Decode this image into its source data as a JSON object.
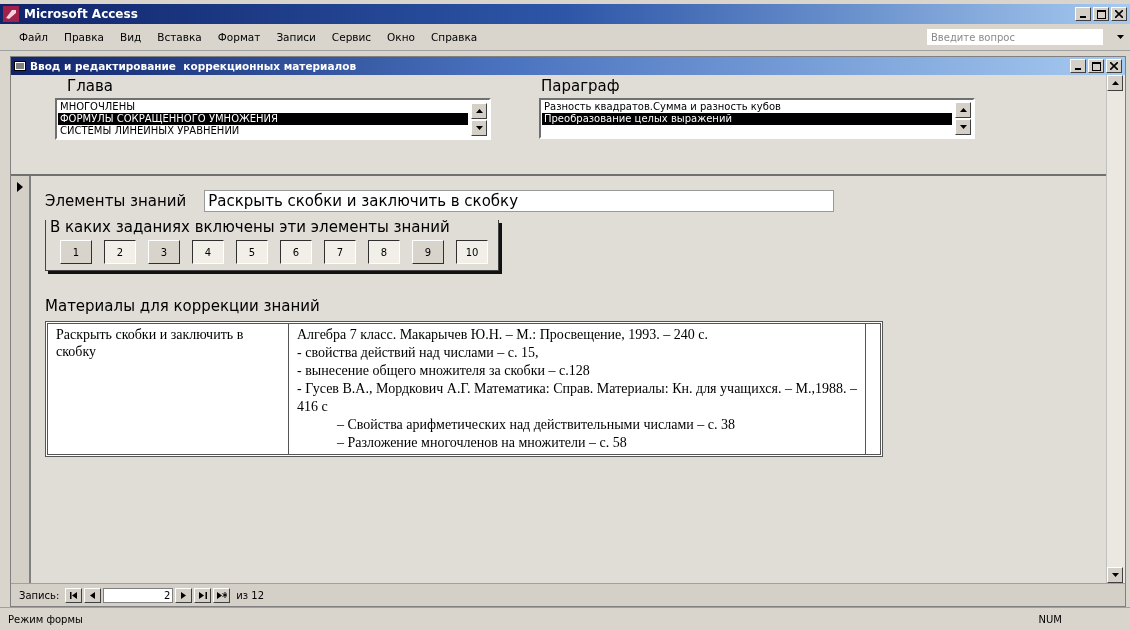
{
  "app_window": {
    "title": "Microsoft Access"
  },
  "menu": [
    {
      "label": "Файл"
    },
    {
      "label": "Правка"
    },
    {
      "label": "Вид"
    },
    {
      "label": "Вставка"
    },
    {
      "label": "Формат"
    },
    {
      "label": "Записи"
    },
    {
      "label": "Сервис"
    },
    {
      "label": "Окно"
    },
    {
      "label": "Справка"
    }
  ],
  "help_search": {
    "placeholder": "Введите вопрос"
  },
  "form_window": {
    "title": "Ввод и редактирование  коррекционных материалов"
  },
  "chapter": {
    "label": "Глава",
    "items": [
      {
        "text": "МНОГОЧЛЕНЫ",
        "selected": false
      },
      {
        "text": "ФОРМУЛЫ СОКРАЩЕННОГО УМНОЖЕНИЯ",
        "selected": true
      },
      {
        "text": "СИСТЕМЫ ЛИНЕЙНЫХ УРАВНЕНИЙ",
        "selected": false
      }
    ]
  },
  "paragraph": {
    "label": "Параграф",
    "items": [
      {
        "text": "Разность квадратов.Сумма и разность кубов",
        "selected": false
      },
      {
        "text": "Преобразование целых выражений",
        "selected": true
      }
    ]
  },
  "knowledge_element": {
    "label": "Элементы знаний",
    "value": "Раскрыть скобки и заключить в скобку"
  },
  "tasks": {
    "label": "В каких заданиях включены эти элементы знаний",
    "buttons": [
      {
        "label": "1",
        "pressed": false
      },
      {
        "label": "2",
        "pressed": true
      },
      {
        "label": "3",
        "pressed": false
      },
      {
        "label": "4",
        "pressed": true
      },
      {
        "label": "5",
        "pressed": true
      },
      {
        "label": "6",
        "pressed": true
      },
      {
        "label": "7",
        "pressed": true
      },
      {
        "label": "8",
        "pressed": true
      },
      {
        "label": "9",
        "pressed": false
      },
      {
        "label": "10",
        "pressed": true
      }
    ]
  },
  "materials": {
    "label": "Материалы для коррекции знаний",
    "topic": "Раскрыть скобки и заключить в скобку",
    "lines": [
      {
        "text": "Алгебра 7 класс. Макарычев Ю.Н. – М.: Просвещение, 1993. – 240 с.",
        "indent": false
      },
      {
        "text": "- свойства действий над числами – с. 15,",
        "indent": false
      },
      {
        "text": "- вынесение общего множителя за скобки – с.128",
        "indent": false
      },
      {
        "text": "- Гусев В.А., Мордкович А.Г. Математика: Справ. Материалы: Кн. для учащихся. – М.,1988. –416 с",
        "indent": false
      },
      {
        "text": "– Свойства арифметических над действительными числами – с. 38",
        "indent": true
      },
      {
        "text": "– Разложение многочленов на множители – с. 58",
        "indent": true
      }
    ]
  },
  "record_nav": {
    "label": "Запись:",
    "value": "2",
    "total": "из 12"
  },
  "status_bar": {
    "mode": "Режим формы",
    "indicator": "NUM"
  }
}
